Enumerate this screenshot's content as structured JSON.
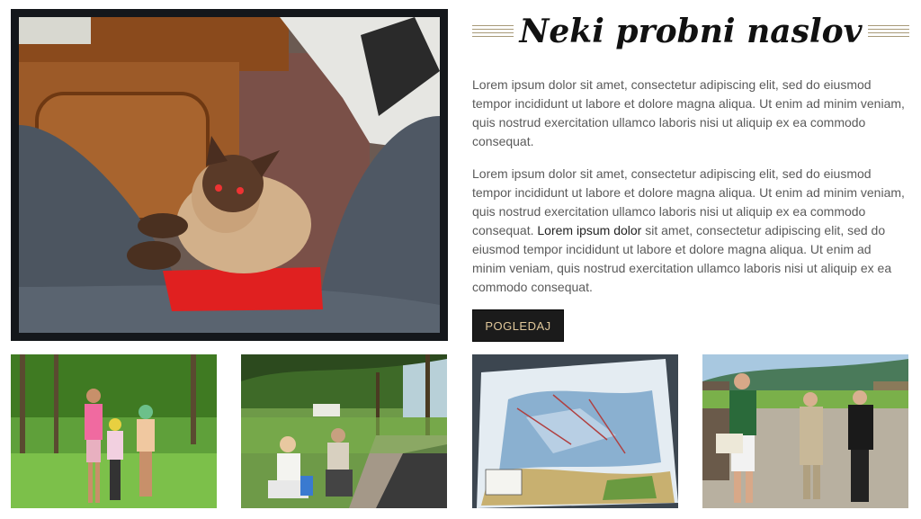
{
  "hero_image": {
    "icon": "cat-photo"
  },
  "article": {
    "title": "Neki probni naslov",
    "paragraph1": "Lorem ipsum dolor sit amet, consectetur adipiscing elit, sed do eiusmod tempor incididunt ut labore et dolore magna aliqua. Ut enim ad minim veniam, quis nostrud exercitation ullamco laboris nisi ut aliquip ex ea commodo consequat.",
    "paragraph2_part1": "Lorem ipsum dolor sit amet, consectetur adipiscing elit, sed do eiusmod tempor incididunt ut labore et dolore magna aliqua. Ut enim ad minim veniam, quis nostrud exercitation ullamco laboris nisi ut aliquip ex ea commodo consequat. ",
    "paragraph2_emphasis": "Lorem ipsum dolor",
    "paragraph2_part2": " sit amet, consectetur adipiscing elit, sed do eiusmod tempor incididunt ut labore et dolore magna aliqua. Ut enim ad minim veniam, quis nostrud exercitation ullamco laboris nisi ut aliquip ex ea commodo consequat.",
    "button_label": "POGLEDAJ"
  },
  "gallery": [
    {
      "icon": "girls-in-meadow-photo"
    },
    {
      "icon": "seated-women-park-photo"
    },
    {
      "icon": "ski-trail-map-photo"
    },
    {
      "icon": "tourists-mountain-photo"
    }
  ],
  "colors": {
    "accent": "#e0c79a",
    "button_bg": "#1b1b1b",
    "text": "#5a5a5a",
    "rule": "#a89a78"
  }
}
